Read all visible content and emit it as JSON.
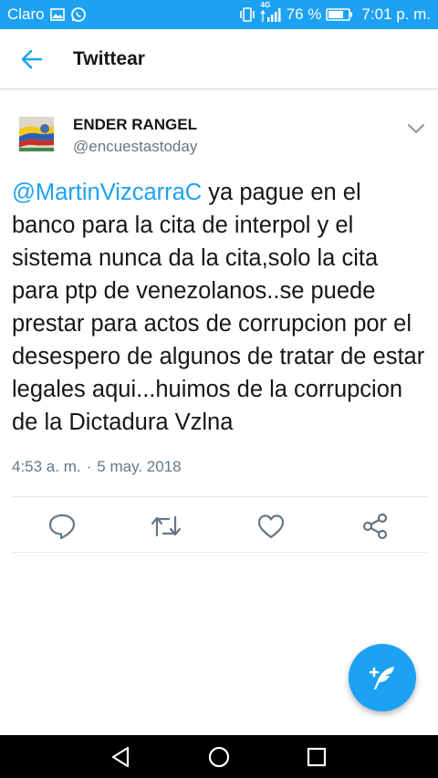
{
  "status_bar": {
    "carrier": "Claro",
    "network_type": "4G",
    "battery_percent": "76 %",
    "time": "7:01 p. m.",
    "background_color": "#1da1f2",
    "icons": [
      "gallery-icon",
      "whatsapp-icon",
      "vibrate-icon",
      "signal-icon",
      "battery-icon"
    ]
  },
  "header": {
    "title": "Twittear",
    "back_icon": "arrow-left-icon",
    "accent_color": "#1da1f2"
  },
  "tweet": {
    "author_name": "ENDER RANGEL",
    "author_handle": "@encuestastoday",
    "mention": "@MartinVizcarraC",
    "body": " ya pague en el banco para la cita de interpol y el sistema nunca da la cita,solo la cita para ptp de venezolanos..se puede prestar para actos de corrupcion por el desespero de algunos de tratar de estar legales aqui...huimos de la corrupcion de la Dictadura Vzlna",
    "time": "4:53 a. m.",
    "separator": "·",
    "date": "5 may. 2018"
  },
  "actions": [
    "reply-icon",
    "retweet-icon",
    "like-icon",
    "share-icon"
  ],
  "fab": {
    "icon": "compose-tweet-icon"
  },
  "nav_bar": [
    "nav-back-icon",
    "nav-home-icon",
    "nav-recents-icon"
  ]
}
